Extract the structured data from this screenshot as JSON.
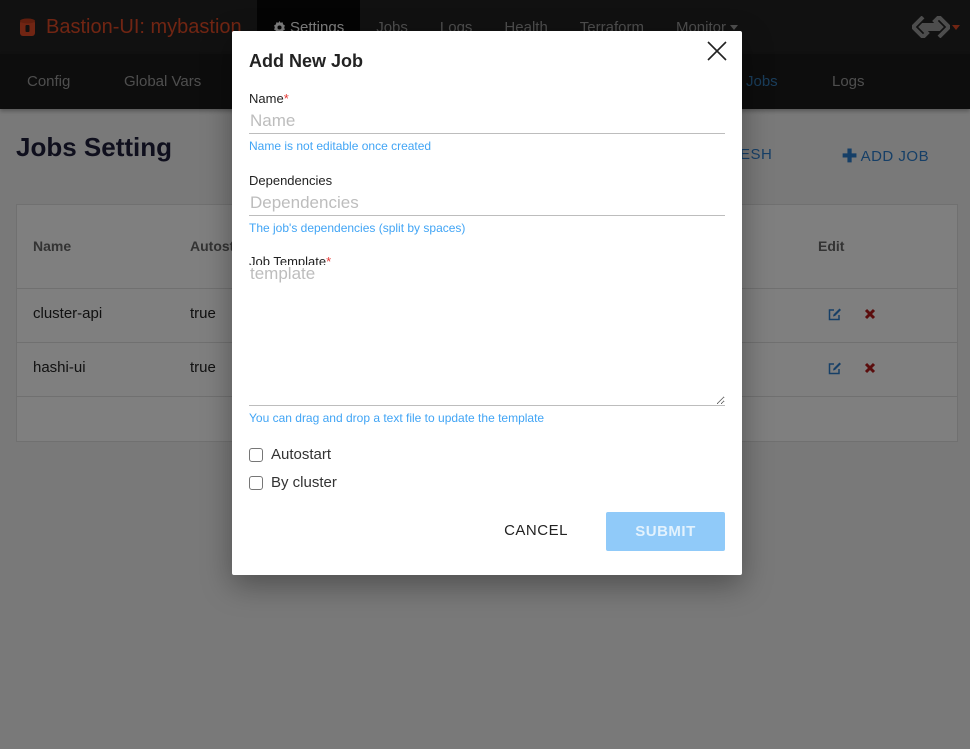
{
  "navbar": {
    "brand": "Bastion-UI: mybastion",
    "items": [
      {
        "label": "Settings",
        "icon": "gear-icon",
        "active": true
      },
      {
        "label": "Jobs"
      },
      {
        "label": "Logs"
      },
      {
        "label": "Health"
      },
      {
        "label": "Terraform"
      },
      {
        "label": "Monitor",
        "dropdown": true
      }
    ],
    "logo_icon": "gs-logo-icon"
  },
  "subnav": {
    "items": [
      {
        "label": "Config"
      },
      {
        "label": "Global Vars"
      },
      {
        "label": "Jobs",
        "active": true
      },
      {
        "label": "Logs"
      }
    ]
  },
  "page": {
    "title": "Jobs Setting",
    "refresh_label": "ESH",
    "add_job_label": "ADD JOB",
    "table": {
      "headers": [
        "Name",
        "Autost",
        "Edit"
      ],
      "rows": [
        {
          "name": "cluster-api",
          "autostart": "true"
        },
        {
          "name": "hashi-ui",
          "autostart": "true"
        }
      ]
    }
  },
  "modal": {
    "title": "Add New Job",
    "name": {
      "label": "Name",
      "required": "*",
      "placeholder": "Name",
      "value": "",
      "help": "Name is not editable once created"
    },
    "dependencies": {
      "label": "Dependencies",
      "placeholder": "Dependencies",
      "value": "",
      "help": "The job's dependencies (split by spaces)"
    },
    "template": {
      "label": "Job Template",
      "required": "*",
      "placeholder": "template",
      "value": "",
      "help": "You can drag and drop a text file to update the template"
    },
    "autostart": {
      "label": "Autostart",
      "checked": false
    },
    "by_cluster": {
      "label": "By cluster",
      "checked": false
    },
    "cancel_label": "CANCEL",
    "submit_label": "SUBMIT"
  },
  "colors": {
    "brand": "#e24b26",
    "accent": "#42a5f5",
    "submit_disabled": "#90caf9",
    "required": "#e53935",
    "delete": "#b71c1c"
  }
}
